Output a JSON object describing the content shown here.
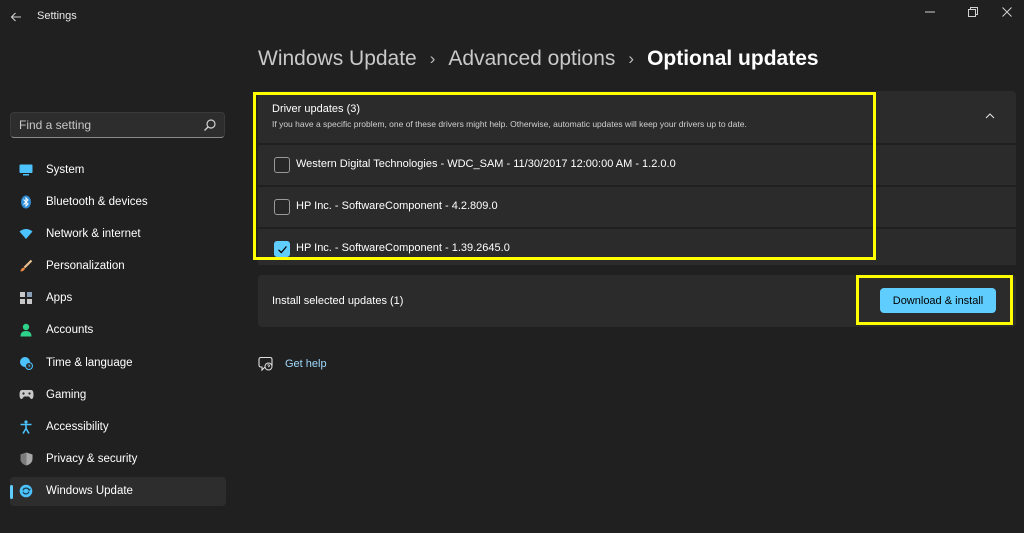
{
  "window": {
    "title": "Settings",
    "back_icon": "arrow-left-icon",
    "controls": [
      "minimize-icon",
      "restore-icon",
      "close-icon"
    ]
  },
  "search": {
    "placeholder": "Find a setting",
    "icon": "search-icon"
  },
  "sidebar": {
    "items": [
      {
        "label": "System",
        "icon": "monitor-icon",
        "color": "#4cc2ff"
      },
      {
        "label": "Bluetooth & devices",
        "icon": "bluetooth-icon",
        "color": "#4cc2ff"
      },
      {
        "label": "Network & internet",
        "icon": "wifi-icon",
        "color": "#4cc2ff"
      },
      {
        "label": "Personalization",
        "icon": "brush-icon",
        "color": "#f0a060"
      },
      {
        "label": "Apps",
        "icon": "apps-icon",
        "color": "#c8c8c8"
      },
      {
        "label": "Accounts",
        "icon": "person-icon",
        "color": "#2fd28a"
      },
      {
        "label": "Time & language",
        "icon": "globe-clock-icon",
        "color": "#4cc2ff"
      },
      {
        "label": "Gaming",
        "icon": "gamepad-icon",
        "color": "#c8c8c8"
      },
      {
        "label": "Accessibility",
        "icon": "accessibility-icon",
        "color": "#4cc2ff"
      },
      {
        "label": "Privacy & security",
        "icon": "shield-icon",
        "color": "#a0a0a0"
      },
      {
        "label": "Windows Update",
        "icon": "update-icon",
        "color": "#4cc2ff",
        "active": true
      }
    ]
  },
  "breadcrumb": {
    "items": [
      "Windows Update",
      "Advanced options",
      "Optional updates"
    ],
    "separator": "›"
  },
  "driver_updates": {
    "title": "Driver updates (3)",
    "description": "If you have a specific problem, one of these drivers might help. Otherwise, automatic updates will keep your drivers up to date.",
    "collapse_icon": "chevron-up-icon",
    "items": [
      {
        "label": "Western Digital Technologies - WDC_SAM - 11/30/2017 12:00:00 AM - 1.2.0.0",
        "checked": false
      },
      {
        "label": "HP Inc. - SoftwareComponent - 4.2.809.0",
        "checked": false
      },
      {
        "label": "HP Inc. - SoftwareComponent - 1.39.2645.0",
        "checked": true
      }
    ]
  },
  "install": {
    "label": "Install selected updates (1)",
    "button_label": "Download & install"
  },
  "help": {
    "label": "Get help",
    "icon": "help-chat-icon"
  },
  "colors": {
    "background": "#202020",
    "card": "#2b2b2b",
    "accent": "#60cdff",
    "highlight": "#ffff00"
  }
}
